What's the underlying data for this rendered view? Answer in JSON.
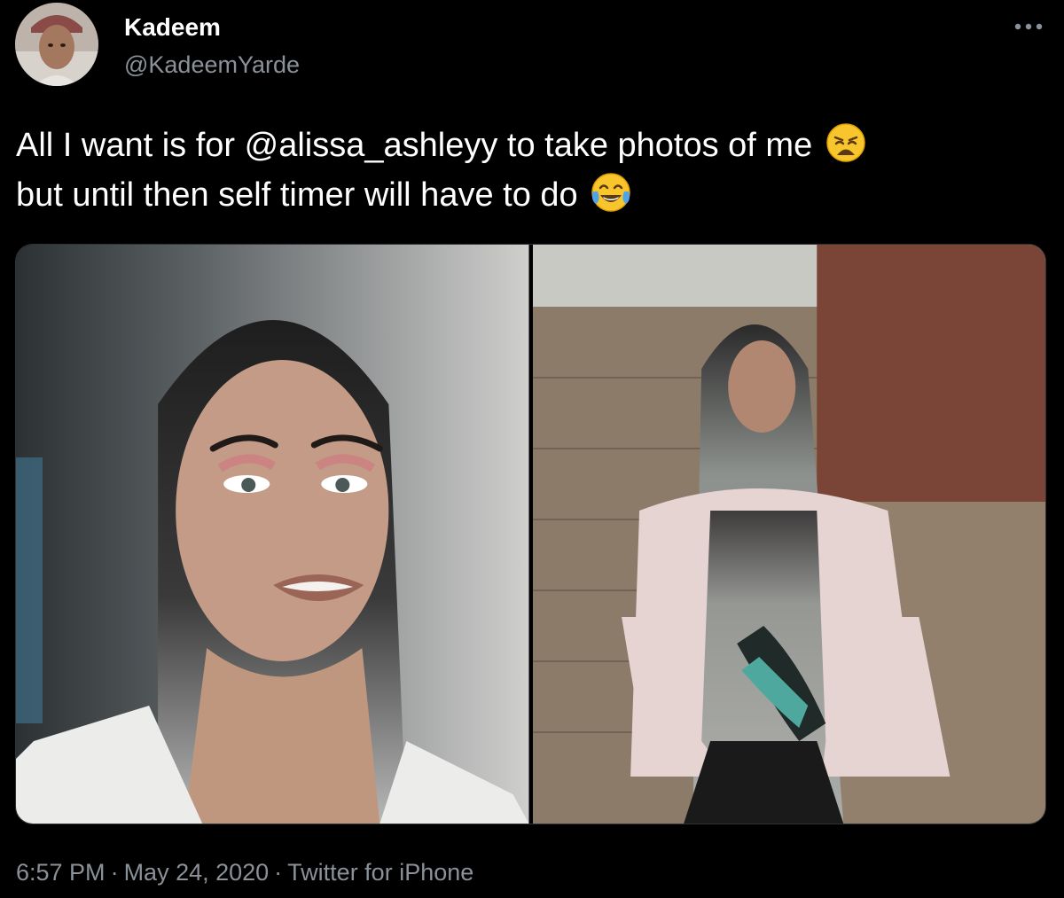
{
  "author": {
    "name": "Kadeem",
    "handle": "@KadeemYarde"
  },
  "tweet": {
    "text_line1": "All I want is for @alissa_ashleyy to take photos of me",
    "text_line1_emoji": "weary-face-emoji",
    "text_line2": "but until then self timer will have to do",
    "text_line2_emoji": "face-with-tears-of-joy-emoji"
  },
  "media": {
    "count": 2
  },
  "meta": {
    "time": "6:57 PM",
    "separator": "·",
    "date": "May 24, 2020",
    "source": "Twitter for iPhone"
  },
  "icons": {
    "more": "more-horizontal-icon"
  },
  "colors": {
    "background": "#000000",
    "primary_text": "#ffffff",
    "secondary_text": "#8b9198",
    "border": "#2f3336"
  }
}
